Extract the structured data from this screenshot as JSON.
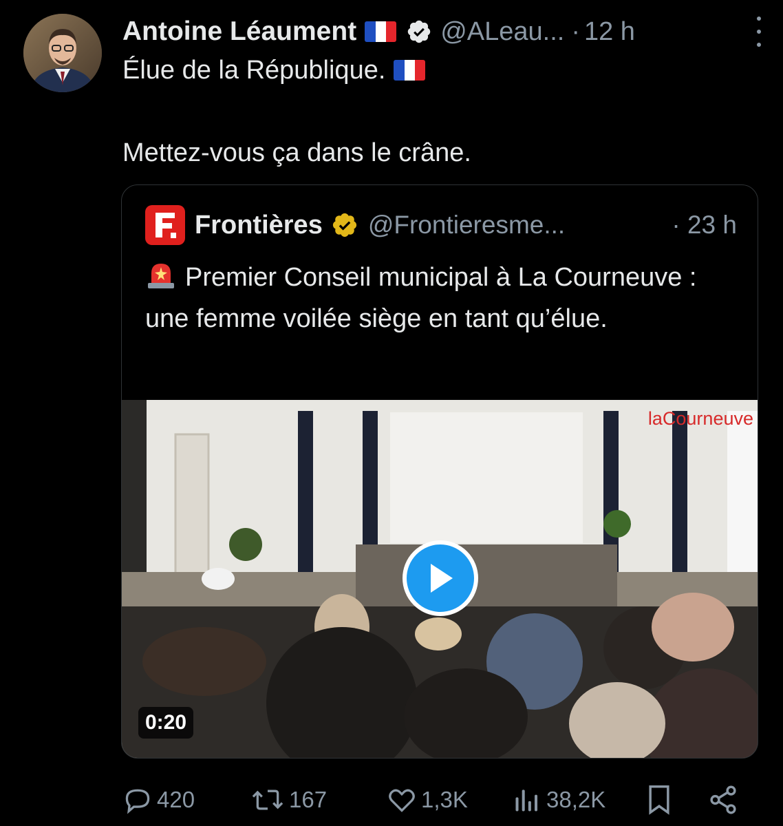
{
  "tweet": {
    "author_name": "Antoine Léaument",
    "author_handle": "@ALeau...",
    "separator": "·",
    "time": "12 h",
    "text_line1": "Élue de la République.",
    "text_line2": "Mettez-vous ça dans le crâne."
  },
  "quoted": {
    "author_name": "Frontières",
    "author_handle": "@Frontieresme...",
    "separator": "·",
    "time": "23 h",
    "text": "Premier Conseil municipal à La Courneuve : une femme voilée siège en tant qu’élue.",
    "video_duration": "0:20",
    "video_watermark": "laCourneuve"
  },
  "actions": {
    "replies": "420",
    "reposts": "167",
    "likes": "1,3K",
    "views": "38,2K"
  },
  "colors": {
    "background": "#000000",
    "text": "#e7e9ea",
    "muted": "#8b98a5",
    "accent": "#1d9bf0",
    "verified_blue": "#1d9bf0",
    "verified_gold": "#e2b719",
    "brand_red": "#e0201d"
  }
}
